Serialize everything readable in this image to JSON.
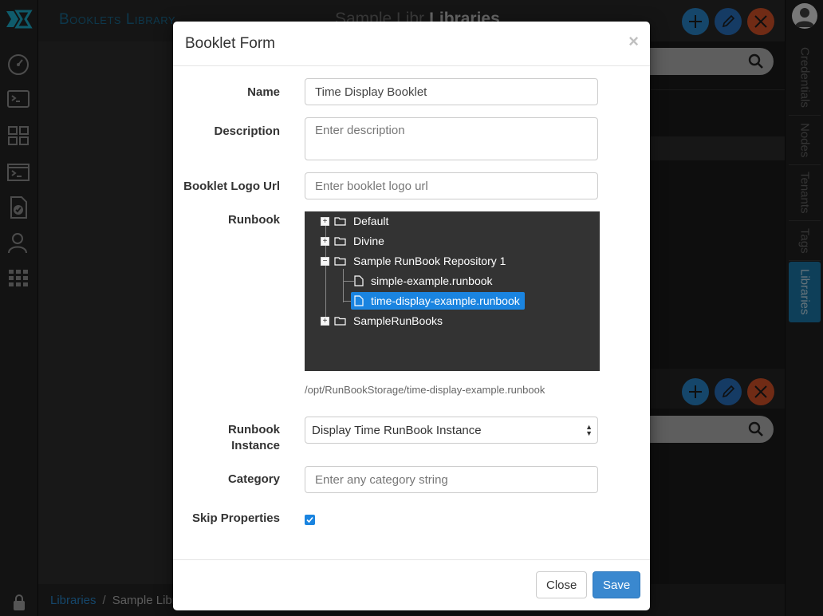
{
  "app": {
    "title": "Booklets Library",
    "heading_faded": "Sample Libr",
    "heading_section": "Libraries"
  },
  "left_nav": {
    "icons": [
      "dashboard-gauge-icon",
      "terminal-icon",
      "libraries-grid-icon",
      "console-icon",
      "runbook-check-icon",
      "users-icon",
      "apps-grid-icon"
    ],
    "bottom_icon": "lock-icon"
  },
  "right_tabs": [
    {
      "label": "Credentials",
      "active": false
    },
    {
      "label": "Nodes",
      "active": false
    },
    {
      "label": "Tenants",
      "active": false
    },
    {
      "label": "Tags",
      "active": false
    },
    {
      "label": "Libraries",
      "active": true
    }
  ],
  "breadcrumb": {
    "link": "Libraries",
    "separator": "/",
    "current": "Sample Libra"
  },
  "modal": {
    "title": "Booklet Form",
    "close_glyph": "×",
    "fields": {
      "name": {
        "label": "Name",
        "value": "Time Display Booklet"
      },
      "description": {
        "label": "Description",
        "placeholder": "Enter description"
      },
      "logo_url": {
        "label": "Booklet Logo Url",
        "placeholder": "Enter booklet logo url"
      },
      "runbook": {
        "label": "Runbook",
        "tree": [
          {
            "label": "Default",
            "type": "folder",
            "expanded": false
          },
          {
            "label": "Divine",
            "type": "folder",
            "expanded": false
          },
          {
            "label": "Sample RunBook Repository 1",
            "type": "folder",
            "expanded": true
          },
          {
            "label": "simple-example.runbook",
            "type": "file",
            "selected": false
          },
          {
            "label": "time-display-example.runbook",
            "type": "file",
            "selected": true
          },
          {
            "label": "SampleRunBooks",
            "type": "folder",
            "expanded": false
          }
        ],
        "selected_path": "/opt/RunBookStorage/time-display-example.runbook"
      },
      "runbook_instance": {
        "label_line1": "Runbook",
        "label_line2": "Instance",
        "value": "Display Time RunBook Instance"
      },
      "category": {
        "label": "Category",
        "placeholder": "Enter any category string"
      },
      "skip_properties": {
        "label": "Skip Properties",
        "checked": true
      }
    },
    "buttons": {
      "close": "Close",
      "save": "Save"
    }
  },
  "colors": {
    "accent": "#1a84e0",
    "add": "#2a8dd4",
    "delete": "#e0562a",
    "save": "#3a88cf"
  }
}
